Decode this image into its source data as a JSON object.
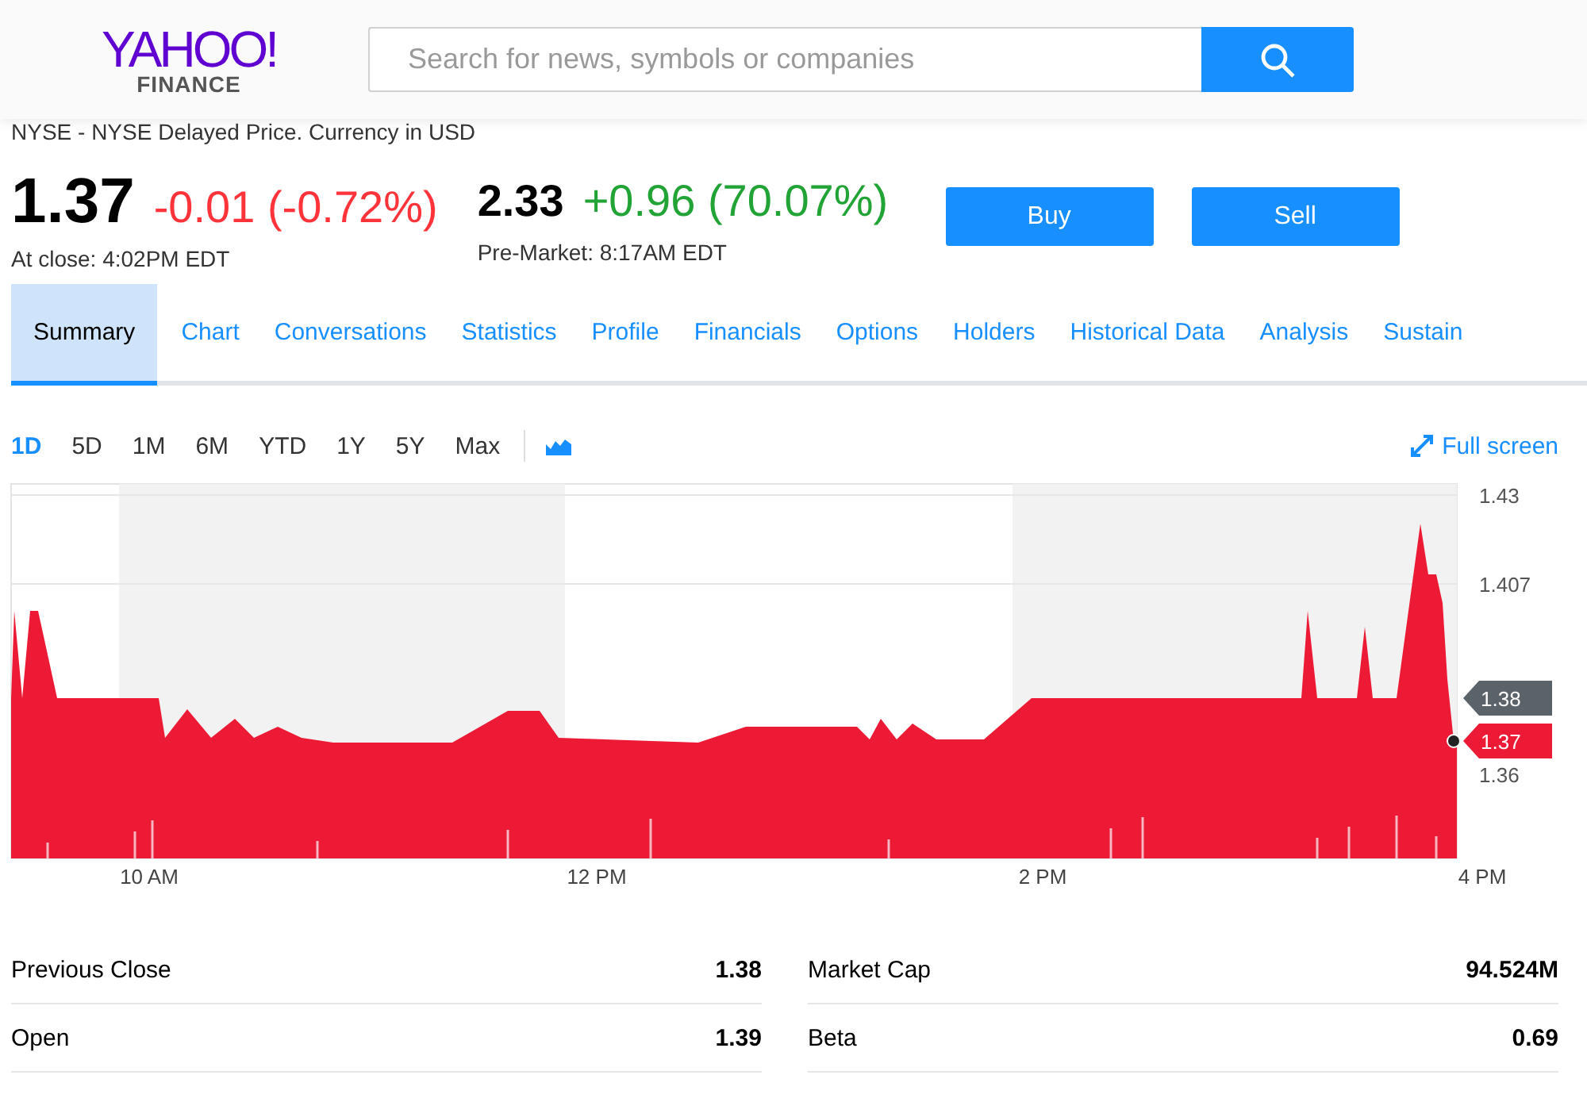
{
  "header": {
    "logo": {
      "wordmark": "YAHOO!",
      "subtitle": "FINANCE"
    },
    "search": {
      "placeholder": "Search for news, symbols or companies"
    }
  },
  "quote": {
    "exchange_note": "NYSE - NYSE Delayed Price. Currency in USD",
    "quotes": [
      {
        "price": "1.37",
        "change": "-0.01 (-0.72%)",
        "color": "#ff333a",
        "time": "At close: 4:02PM EDT"
      },
      {
        "price": "2.33",
        "change": "+0.96 (70.07%)",
        "color": "#21a336",
        "time": "Pre-Market: 8:17AM EDT"
      }
    ],
    "buttons": [
      "Buy",
      "Sell"
    ]
  },
  "tabs": [
    {
      "label": "Summary",
      "selected": true
    },
    {
      "label": "Chart",
      "selected": false
    },
    {
      "label": "Conversations",
      "selected": false
    },
    {
      "label": "Statistics",
      "selected": false
    },
    {
      "label": "Profile",
      "selected": false
    },
    {
      "label": "Financials",
      "selected": false
    },
    {
      "label": "Options",
      "selected": false
    },
    {
      "label": "Holders",
      "selected": false
    },
    {
      "label": "Historical Data",
      "selected": false
    },
    {
      "label": "Analysis",
      "selected": false
    },
    {
      "label": "Sustain",
      "selected": false
    }
  ],
  "chart": {
    "ranges": [
      {
        "label": "1D",
        "selected": true
      },
      {
        "label": "5D",
        "selected": false
      },
      {
        "label": "1M",
        "selected": false
      },
      {
        "label": "6M",
        "selected": false
      },
      {
        "label": "YTD",
        "selected": false
      },
      {
        "label": "1Y",
        "selected": false
      },
      {
        "label": "5Y",
        "selected": false
      },
      {
        "label": "Max",
        "selected": false
      }
    ],
    "full_screen": "Full screen",
    "price_flags": [
      {
        "label": "1.38",
        "kind": "previous"
      },
      {
        "label": "1.37",
        "kind": "last"
      }
    ],
    "y_axis_labels": [
      "1.43",
      "1.407",
      "1.36"
    ],
    "x_axis_labels": [
      "10 AM",
      "12 PM",
      "2 PM",
      "4 PM"
    ]
  },
  "stats": {
    "left": [
      {
        "label": "Previous Close",
        "value": "1.38"
      },
      {
        "label": "Open",
        "value": "1.39"
      }
    ],
    "right": [
      {
        "label": "Market Cap",
        "value": "94.524M"
      },
      {
        "label": "Beta",
        "value": "0.69"
      }
    ]
  }
}
